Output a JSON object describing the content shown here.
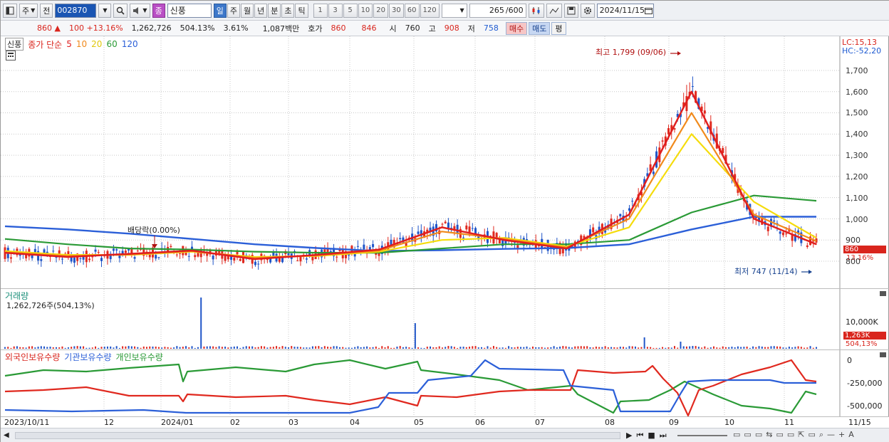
{
  "toolbar": {
    "market_label": "주",
    "prev_label": "전",
    "stock_code": "002870",
    "sig_label": "종",
    "stock_name": "신풍",
    "period_buttons": [
      "일",
      "주",
      "월",
      "년",
      "분",
      "초",
      "틱"
    ],
    "selected_period": "일",
    "interval_buttons": [
      "1",
      "3",
      "5",
      "10",
      "20",
      "30",
      "60",
      "120"
    ],
    "count_value": "265",
    "count_total": "/600",
    "date": "2024/11/15"
  },
  "quote": {
    "price": "860",
    "direction": "▲",
    "change": "100",
    "change_pct": "+13.16%",
    "volume": "1,262,726",
    "volume_ratio": "504.13%",
    "turnover": "3.61%",
    "amount": "1,087백만",
    "bidask_label": "호가",
    "bid": "860",
    "ask": "846",
    "open_label": "시",
    "open": "760",
    "high_label": "고",
    "high": "908",
    "low_label": "저",
    "low": "758",
    "buy_label": "매수",
    "sell_label": "매도",
    "eval_label": "평"
  },
  "price_panel": {
    "stock_name": "신풍",
    "indicator_label": "종가 단순",
    "ma_periods": [
      {
        "label": "5",
        "color": "#e01e1e"
      },
      {
        "label": "10",
        "color": "#f08a1c"
      },
      {
        "label": "20",
        "color": "#f5dc0c"
      },
      {
        "label": "60",
        "color": "#2a9a36"
      },
      {
        "label": "120",
        "color": "#2b5fd8"
      }
    ],
    "lc_text": "LC:15,13",
    "hc_text": "HC:-52,20",
    "annot_high": "최고 1,799 (09/06)",
    "annot_low": "최저 747 (11/14)",
    "annot_dividend": "배당락(0.00%)",
    "price_tag": "860",
    "pct_tag": "13.16%",
    "y_ticks": [
      "1,700",
      "1,600",
      "1,500",
      "1,400",
      "1,300",
      "1,200",
      "1,100",
      "1,000",
      "900",
      "800"
    ]
  },
  "volume_panel": {
    "title": "거래량",
    "info": "1,262,726주(504,13%)",
    "y_tick": "10,000K",
    "tag": "1,263K",
    "tag2": "504,13%"
  },
  "holding_panel": {
    "series_labels": [
      "외국인보유수량",
      "기관보유수량",
      "개인보유수량"
    ],
    "y_ticks": [
      "0",
      "-250,000",
      "-500,000"
    ]
  },
  "x_axis": {
    "labels": [
      "2023/10/11",
      "12",
      "2024/01",
      "02",
      "03",
      "04",
      "05",
      "06",
      "07",
      "08",
      "09",
      "10",
      "11",
      "11/15"
    ]
  },
  "chart_data": {
    "type": "candlestick-line",
    "title": "신풍",
    "y_range": [
      700,
      1800
    ],
    "categories": [
      "2023/10",
      "2023/11",
      "2023/12",
      "2024/01",
      "2024/02",
      "2024/03",
      "2024/04",
      "2024/05",
      "2024/06",
      "2024/07",
      "2024/08",
      "2024/09",
      "2024/10",
      "2024/11"
    ],
    "series": [
      {
        "name": "5",
        "values": [
          840,
          820,
          835,
          850,
          810,
          830,
          855,
          960,
          900,
          860,
          1020,
          1600,
          1000,
          880
        ]
      },
      {
        "name": "10",
        "values": [
          842,
          825,
          832,
          848,
          815,
          828,
          850,
          940,
          905,
          865,
          1000,
          1500,
          1020,
          895
        ]
      },
      {
        "name": "20",
        "values": [
          848,
          830,
          830,
          845,
          820,
          825,
          845,
          900,
          910,
          870,
          960,
          1400,
          1080,
          910
        ]
      },
      {
        "name": "60",
        "values": [
          905,
          880,
          860,
          855,
          845,
          840,
          840,
          860,
          880,
          880,
          900,
          1030,
          1110,
          1085
        ]
      },
      {
        "name": "120",
        "values": [
          965,
          950,
          930,
          905,
          880,
          862,
          848,
          852,
          858,
          862,
          880,
          950,
          1010,
          1010
        ]
      }
    ],
    "high": {
      "value": 1799,
      "date": "09/06"
    },
    "low": {
      "value": 747,
      "date": "11/14"
    }
  }
}
